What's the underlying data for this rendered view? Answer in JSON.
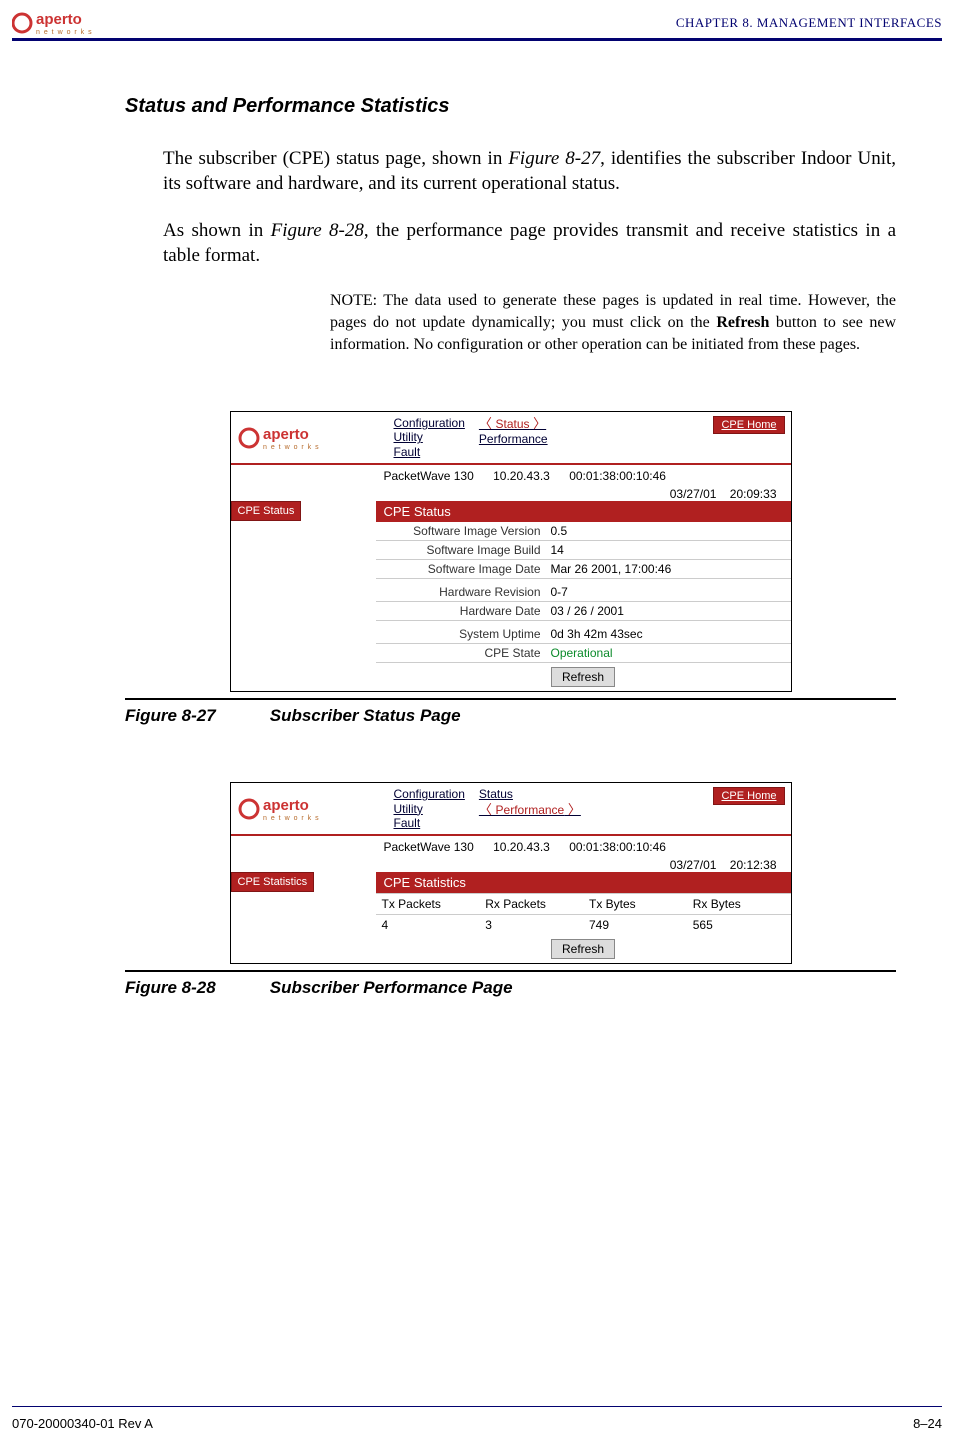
{
  "header": {
    "logo_text": "aperto networks",
    "chapter_label": "CHAPTER 8.   MANAGEMENT INTERFACES"
  },
  "section_title": "Status and Performance Statistics",
  "para1_a": "The subscriber (CPE) status page, shown in ",
  "para1_ref": "Figure 8-27",
  "para1_b": ", identifies the subscriber Indoor Unit, its software and hardware, and its current operational status.",
  "para2_a": "As shown in ",
  "para2_ref": "Figure 8-28",
  "para2_b": ", the performance page provides transmit and receive statistics in a table format.",
  "note_a": "NOTE:  The data used to generate these pages is updated in real time. However, the pages do not update dynamically; you must click on the ",
  "note_bold": "Refresh",
  "note_b": " button to see new information. No configuration or other operation can be initiated from these pages.",
  "fig27": {
    "num": "Figure 8-27",
    "title": "Subscriber Status Page",
    "nav_col1": [
      "Configuration",
      "Utility",
      "Fault"
    ],
    "nav_col2": [
      "Status",
      "Performance"
    ],
    "cpe_home": "CPE Home",
    "side_tab": "CPE Status",
    "info_model": "PacketWave 130",
    "info_ip": "10.20.43.3",
    "info_mac": "00:01:38:00:10:46",
    "info_date": "03/27/01",
    "info_time": "20:09:33",
    "panel_title": "CPE Status",
    "rows": [
      {
        "k": "Software Image Version",
        "v": "0.5"
      },
      {
        "k": "Software Image Build",
        "v": "14"
      },
      {
        "k": "Software Image Date",
        "v": "Mar 26 2001, 17:00:46"
      }
    ],
    "rows2": [
      {
        "k": "Hardware Revision",
        "v": "0-7"
      },
      {
        "k": "Hardware Date",
        "v": "03 / 26 / 2001"
      }
    ],
    "rows3": [
      {
        "k": "System Uptime",
        "v": "0d 3h 42m 43sec"
      },
      {
        "k": "CPE State",
        "v": "Operational",
        "op": true
      }
    ],
    "refresh": "Refresh"
  },
  "fig28": {
    "num": "Figure 8-28",
    "title": "Subscriber Performance Page",
    "nav_col1": [
      "Configuration",
      "Utility",
      "Fault"
    ],
    "nav_col2": [
      "Status",
      "Performance"
    ],
    "cpe_home": "CPE Home",
    "side_tab": "CPE Statistics",
    "info_model": "PacketWave 130",
    "info_ip": "10.20.43.3",
    "info_mac": "00:01:38:00:10:46",
    "info_date": "03/27/01",
    "info_time": "20:12:38",
    "panel_title": "CPE Statistics",
    "headers": [
      "Tx Packets",
      "Rx Packets",
      "Tx Bytes",
      "Rx Bytes"
    ],
    "values": [
      "4",
      "3",
      "749",
      "565"
    ],
    "refresh": "Refresh"
  },
  "footer": {
    "left": "070-20000340-01 Rev A",
    "right": "8–24"
  }
}
